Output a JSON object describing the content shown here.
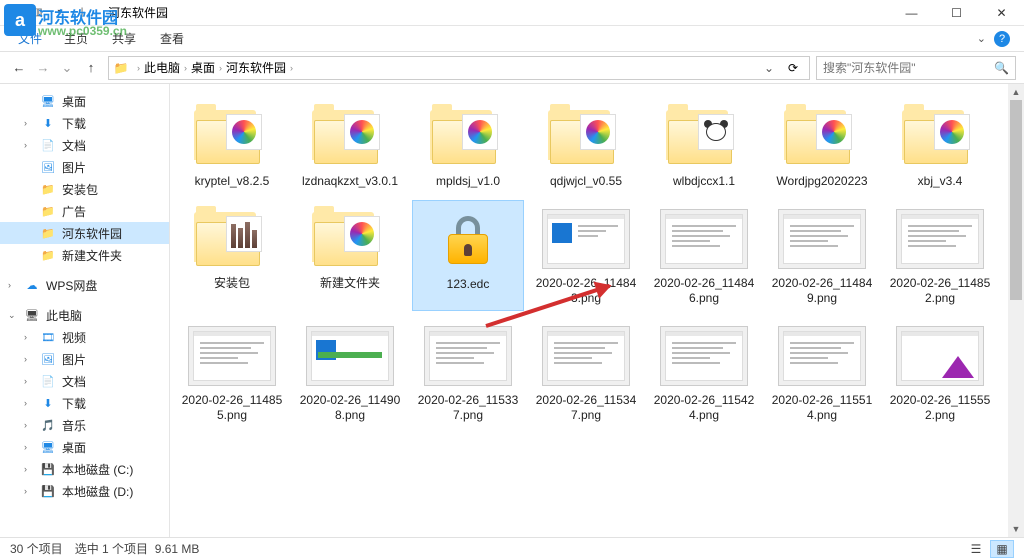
{
  "watermark": {
    "brand": "河东软件园",
    "url": "www.pc0359.cn",
    "badge": "a"
  },
  "titlebar": {
    "title": "河东软件园"
  },
  "ribbon": {
    "file": "文件",
    "tabs": [
      "主页",
      "共享",
      "查看"
    ]
  },
  "breadcrumb": {
    "parts": [
      "此电脑",
      "桌面",
      "河东软件园"
    ]
  },
  "search": {
    "placeholder": "搜索\"河东软件园\""
  },
  "sidebar": {
    "items": [
      {
        "label": "桌面",
        "icon": "desktop",
        "color": "ic-blue",
        "caret": false
      },
      {
        "label": "下载",
        "icon": "download",
        "color": "ic-blue",
        "caret": true
      },
      {
        "label": "文档",
        "icon": "document",
        "color": "ic-blue",
        "caret": true
      },
      {
        "label": "图片",
        "icon": "picture",
        "color": "ic-blue",
        "caret": false
      },
      {
        "label": "安装包",
        "icon": "folder",
        "color": "ic-folder",
        "caret": false
      },
      {
        "label": "广告",
        "icon": "folder",
        "color": "ic-folder",
        "caret": false
      },
      {
        "label": "河东软件园",
        "icon": "folder",
        "color": "ic-folder",
        "caret": false,
        "selected": true
      },
      {
        "label": "新建文件夹",
        "icon": "folder",
        "color": "ic-folder",
        "caret": false
      }
    ],
    "wps": {
      "label": "WPS网盘"
    },
    "thispc": {
      "label": "此电脑"
    },
    "pc_children": [
      {
        "label": "视频",
        "icon": "video",
        "color": "ic-blue"
      },
      {
        "label": "图片",
        "icon": "picture",
        "color": "ic-blue"
      },
      {
        "label": "文档",
        "icon": "document",
        "color": "ic-blue"
      },
      {
        "label": "下载",
        "icon": "download",
        "color": "ic-blue"
      },
      {
        "label": "音乐",
        "icon": "music",
        "color": "ic-blue"
      },
      {
        "label": "桌面",
        "icon": "desktop",
        "color": "ic-blue"
      },
      {
        "label": "本地磁盘 (C:)",
        "icon": "disk",
        "color": "ic-disk"
      },
      {
        "label": "本地磁盘 (D:)",
        "icon": "disk",
        "color": "ic-disk"
      }
    ]
  },
  "items": [
    {
      "label": "kryptel_v8.2.5",
      "type": "folder-pinwheel"
    },
    {
      "label": "lzdnaqkzxt_v3.0.1",
      "type": "folder-pinwheel"
    },
    {
      "label": "mpldsj_v1.0",
      "type": "folder-pinwheel"
    },
    {
      "label": "qdjwjcl_v0.55",
      "type": "folder-pinwheel"
    },
    {
      "label": "wlbdjccx1.1",
      "type": "folder-panda"
    },
    {
      "label": "Wordjpg2020223",
      "type": "folder-pinwheel"
    },
    {
      "label": "xbj_v3.4",
      "type": "folder-pinwheel"
    },
    {
      "label": "安装包",
      "type": "folder-bars"
    },
    {
      "label": "新建文件夹",
      "type": "folder-pinwheel"
    },
    {
      "label": "123.edc",
      "type": "lock",
      "selected": true
    },
    {
      "label": "2020-02-26_114843.png",
      "type": "screenshot-blue"
    },
    {
      "label": "2020-02-26_114846.png",
      "type": "screenshot-lines"
    },
    {
      "label": "2020-02-26_114849.png",
      "type": "screenshot-lines"
    },
    {
      "label": "2020-02-26_114852.png",
      "type": "screenshot-lines"
    },
    {
      "label": "2020-02-26_114855.png",
      "type": "screenshot-lines"
    },
    {
      "label": "2020-02-26_114908.png",
      "type": "screenshot-bluegreen"
    },
    {
      "label": "2020-02-26_115337.png",
      "type": "screenshot-lines"
    },
    {
      "label": "2020-02-26_115347.png",
      "type": "screenshot-lines"
    },
    {
      "label": "2020-02-26_115424.png",
      "type": "screenshot-lines"
    },
    {
      "label": "2020-02-26_115514.png",
      "type": "screenshot-lines"
    },
    {
      "label": "2020-02-26_115552.png",
      "type": "screenshot-tri"
    }
  ],
  "statusbar": {
    "count": "30 个项目",
    "selection": "选中 1 个项目",
    "size": "9.61 MB"
  }
}
